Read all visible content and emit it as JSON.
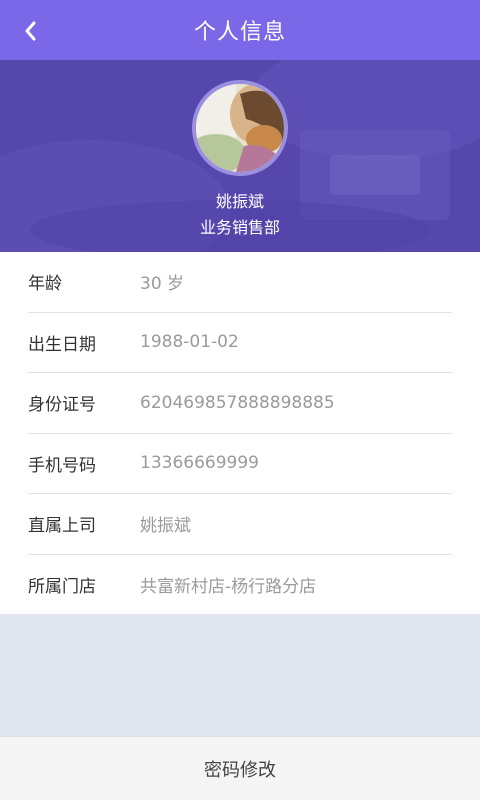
{
  "header": {
    "title": "个人信息",
    "back_icon": "chevron-left-icon"
  },
  "profile": {
    "name": "姚振斌",
    "department": "业务销售部"
  },
  "info": [
    {
      "label": "年龄",
      "value": "30 岁"
    },
    {
      "label": "出生日期",
      "value": "1988-01-02"
    },
    {
      "label": "身份证号",
      "value": "620469857888898885"
    },
    {
      "label": "手机号码",
      "value": "13366669999"
    },
    {
      "label": "直属上司",
      "value": "姚振斌"
    },
    {
      "label": "所属门店",
      "value": "共富新村店-杨行路分店"
    }
  ],
  "footer": {
    "change_password_label": "密码修改"
  },
  "colors": {
    "header": "#7b68e8",
    "hero": "#5d4fb3",
    "background": "#e2e6ee"
  }
}
